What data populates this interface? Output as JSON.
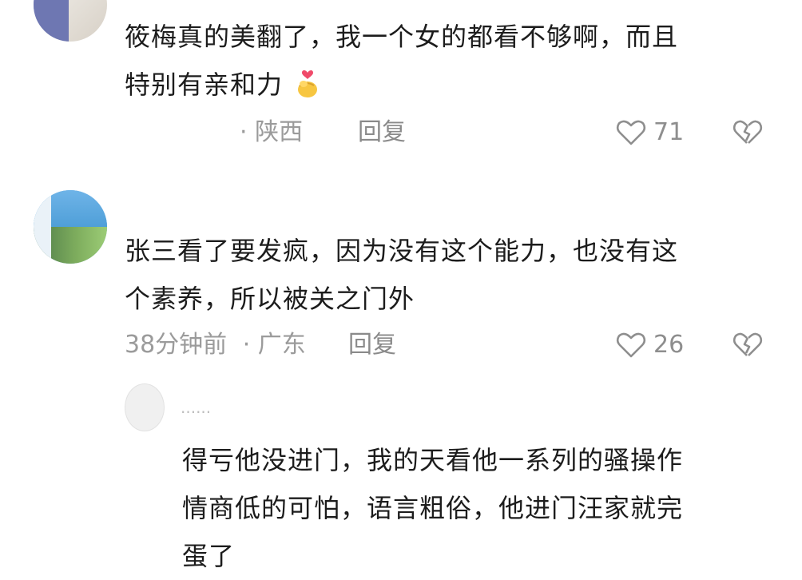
{
  "comments": [
    {
      "text_line1": "筱梅真的美翻了，我一个女的都看不够啊，而且",
      "text_line2": "特别有亲和力",
      "emoji_icon": "finger-heart-emoji",
      "time": "",
      "location": "· 陕西",
      "reply_label": "回复",
      "likes": "71"
    },
    {
      "text_line1": "张三看了要发疯，因为没有这个能力，也没有这",
      "text_line2": "个素养，所以被关之门外",
      "time": "38分钟前",
      "location": "· 广东",
      "reply_label": "回复",
      "likes": "26"
    }
  ],
  "reply": {
    "username": "......",
    "text_line1": "得亏他没进门，我的天看他一系列的骚操作",
    "text_line2": "情商低的可怕，语言粗俗，他进门汪家就完",
    "text_line3": "蛋了"
  },
  "colors": {
    "text": "#1c1c1c",
    "meta": "#9b9b9b",
    "icon": "#8e8e8e"
  }
}
